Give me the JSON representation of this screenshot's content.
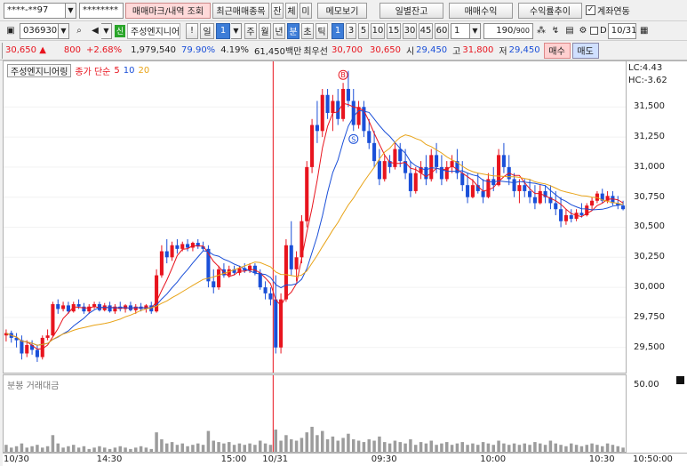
{
  "toolbar1": {
    "account_masked": "****-**97",
    "password_masked": "********",
    "btn_trade_mark": "매매마크/내역 조회",
    "btn_recent_items": "최근매매종목",
    "btn_balance": "잔",
    "btn_fill": "체",
    "btn_unfilled": "미",
    "btn_memo": "메모보기",
    "btn_daily_balance": "일별잔고",
    "btn_trade_profit": "매매수익",
    "btn_profit_trend": "수익률추이",
    "account_link_label": "계좌연동",
    "account_link_checked": true
  },
  "toolbar2": {
    "stock_code": "036930",
    "market_badge": "신",
    "stock_name": "주성엔지니어",
    "period_day": "일",
    "period_day_count": "1",
    "period_week": "주",
    "period_month": "월",
    "period_year": "년",
    "period_minute": "분",
    "period_second": "초",
    "period_tick": "틱",
    "minute_options": [
      "1",
      "3",
      "5",
      "10",
      "15",
      "30",
      "45",
      "60"
    ],
    "minute_selected": "1",
    "custom_minute": "1",
    "count_display": "190",
    "count_total": "900",
    "date_value": "10/31",
    "date_prefix": "D"
  },
  "quote": {
    "price": "30,650",
    "change_arrow": "▲",
    "change": "800",
    "change_pct": "+2.68%",
    "volume": "1,979,540",
    "volume_ratio": "79.90%",
    "turnover_rate": "4.19%",
    "amount": "61,450백만",
    "priority_label": "최우선",
    "best_ask": "30,700",
    "best_bid": "30,650",
    "open_label": "시",
    "open": "29,450",
    "high_label": "고",
    "high": "31,800",
    "low_label": "저",
    "low": "29,450",
    "buy_label": "매수",
    "sell_label": "매도"
  },
  "chart_legend": {
    "stock_name": "주성엔지니어링",
    "ma_title": "종가 단순",
    "ma_periods": [
      "5",
      "10",
      "20"
    ],
    "ma_colors": [
      "#e8141e",
      "#1a4fd8",
      "#e8a317"
    ],
    "lc_label": "LC:4.43",
    "hc_label": "HC:-3.62"
  },
  "volume_legend": {
    "title": "분봉 거래대금"
  },
  "markers": {
    "buy": "B",
    "sell": "S"
  },
  "axis": {
    "price_ticks": [
      "31,500",
      "31,250",
      "31,000",
      "30,750",
      "30,500",
      "30,250",
      "30,000",
      "29,750",
      "29,500"
    ],
    "volume_ticks": [
      "50.00"
    ],
    "time_labels": [
      "10/30",
      "14:30",
      "15:00",
      "10/31",
      "09:30",
      "10:00",
      "10:30"
    ],
    "current_time": "10:50:00"
  },
  "colors": {
    "up": "#e8141e",
    "down": "#1a4fd8",
    "day_divider": "#e8141e",
    "volume_bar": "#9c9c9c"
  },
  "chart_data": {
    "type": "candlestick",
    "price_range": [
      29350,
      31820
    ],
    "day_boundary_index": 52,
    "candles": [
      {
        "o": 29600,
        "h": 29650,
        "l": 29550,
        "c": 29620
      },
      {
        "o": 29620,
        "h": 29640,
        "l": 29540,
        "c": 29580
      },
      {
        "o": 29580,
        "h": 29620,
        "l": 29500,
        "c": 29560
      },
      {
        "o": 29560,
        "h": 29600,
        "l": 29400,
        "c": 29450
      },
      {
        "o": 29450,
        "h": 29560,
        "l": 29420,
        "c": 29520
      },
      {
        "o": 29520,
        "h": 29560,
        "l": 29440,
        "c": 29480
      },
      {
        "o": 29480,
        "h": 29520,
        "l": 29380,
        "c": 29420
      },
      {
        "o": 29420,
        "h": 29600,
        "l": 29400,
        "c": 29580
      },
      {
        "o": 29580,
        "h": 29650,
        "l": 29560,
        "c": 29600
      },
      {
        "o": 29600,
        "h": 29880,
        "l": 29590,
        "c": 29860
      },
      {
        "o": 29860,
        "h": 29900,
        "l": 29780,
        "c": 29820
      },
      {
        "o": 29820,
        "h": 29880,
        "l": 29800,
        "c": 29850
      },
      {
        "o": 29850,
        "h": 29880,
        "l": 29780,
        "c": 29800
      },
      {
        "o": 29800,
        "h": 29880,
        "l": 29790,
        "c": 29860
      },
      {
        "o": 29860,
        "h": 29900,
        "l": 29820,
        "c": 29840
      },
      {
        "o": 29840,
        "h": 29870,
        "l": 29780,
        "c": 29800
      },
      {
        "o": 29800,
        "h": 29860,
        "l": 29780,
        "c": 29840
      },
      {
        "o": 29840,
        "h": 29880,
        "l": 29820,
        "c": 29860
      },
      {
        "o": 29860,
        "h": 29880,
        "l": 29800,
        "c": 29810
      },
      {
        "o": 29810,
        "h": 29870,
        "l": 29800,
        "c": 29850
      },
      {
        "o": 29850,
        "h": 29880,
        "l": 29790,
        "c": 29800
      },
      {
        "o": 29800,
        "h": 29860,
        "l": 29780,
        "c": 29840
      },
      {
        "o": 29840,
        "h": 29880,
        "l": 29800,
        "c": 29820
      },
      {
        "o": 29820,
        "h": 29860,
        "l": 29790,
        "c": 29850
      },
      {
        "o": 29850,
        "h": 29880,
        "l": 29800,
        "c": 29810
      },
      {
        "o": 29810,
        "h": 29860,
        "l": 29780,
        "c": 29840
      },
      {
        "o": 29840,
        "h": 29870,
        "l": 29800,
        "c": 29820
      },
      {
        "o": 29820,
        "h": 29860,
        "l": 29790,
        "c": 29850
      },
      {
        "o": 29850,
        "h": 29880,
        "l": 29780,
        "c": 29800
      },
      {
        "o": 29800,
        "h": 30150,
        "l": 29790,
        "c": 30100
      },
      {
        "o": 30100,
        "h": 30350,
        "l": 30080,
        "c": 30300
      },
      {
        "o": 30300,
        "h": 30400,
        "l": 30200,
        "c": 30250
      },
      {
        "o": 30250,
        "h": 30380,
        "l": 30220,
        "c": 30350
      },
      {
        "o": 30350,
        "h": 30400,
        "l": 30280,
        "c": 30320
      },
      {
        "o": 30320,
        "h": 30380,
        "l": 30300,
        "c": 30360
      },
      {
        "o": 30360,
        "h": 30400,
        "l": 30300,
        "c": 30330
      },
      {
        "o": 30330,
        "h": 30380,
        "l": 30300,
        "c": 30370
      },
      {
        "o": 30370,
        "h": 30400,
        "l": 30320,
        "c": 30340
      },
      {
        "o": 30340,
        "h": 30380,
        "l": 30300,
        "c": 30320
      },
      {
        "o": 30320,
        "h": 30350,
        "l": 30000,
        "c": 30050
      },
      {
        "o": 30050,
        "h": 30150,
        "l": 29950,
        "c": 30000
      },
      {
        "o": 30000,
        "h": 30180,
        "l": 29980,
        "c": 30150
      },
      {
        "o": 30150,
        "h": 30200,
        "l": 30080,
        "c": 30100
      },
      {
        "o": 30100,
        "h": 30180,
        "l": 30080,
        "c": 30150
      },
      {
        "o": 30150,
        "h": 30180,
        "l": 30100,
        "c": 30120
      },
      {
        "o": 30120,
        "h": 30180,
        "l": 30100,
        "c": 30160
      },
      {
        "o": 30160,
        "h": 30200,
        "l": 30120,
        "c": 30140
      },
      {
        "o": 30140,
        "h": 30200,
        "l": 30120,
        "c": 30180
      },
      {
        "o": 30180,
        "h": 30200,
        "l": 30100,
        "c": 30120
      },
      {
        "o": 30120,
        "h": 30150,
        "l": 29980,
        "c": 30000
      },
      {
        "o": 30000,
        "h": 30050,
        "l": 29900,
        "c": 29950
      },
      {
        "o": 29950,
        "h": 30000,
        "l": 29850,
        "c": 29900
      },
      {
        "o": 29900,
        "h": 30100,
        "l": 29450,
        "c": 29500
      },
      {
        "o": 29500,
        "h": 29950,
        "l": 29450,
        "c": 29900
      },
      {
        "o": 29900,
        "h": 30400,
        "l": 29880,
        "c": 30350
      },
      {
        "o": 30350,
        "h": 30550,
        "l": 30100,
        "c": 30150
      },
      {
        "o": 30150,
        "h": 30300,
        "l": 30050,
        "c": 30250
      },
      {
        "o": 30250,
        "h": 30600,
        "l": 30200,
        "c": 30550
      },
      {
        "o": 30550,
        "h": 31050,
        "l": 30500,
        "c": 31000
      },
      {
        "o": 31000,
        "h": 31400,
        "l": 30950,
        "c": 31350
      },
      {
        "o": 31350,
        "h": 31550,
        "l": 31200,
        "c": 31300
      },
      {
        "o": 31300,
        "h": 31650,
        "l": 31250,
        "c": 31600
      },
      {
        "o": 31600,
        "h": 31650,
        "l": 31400,
        "c": 31450
      },
      {
        "o": 31450,
        "h": 31600,
        "l": 31300,
        "c": 31550
      },
      {
        "o": 31550,
        "h": 31650,
        "l": 31350,
        "c": 31400
      },
      {
        "o": 31400,
        "h": 31700,
        "l": 31380,
        "c": 31650
      },
      {
        "o": 31650,
        "h": 31800,
        "l": 31500,
        "c": 31550
      },
      {
        "o": 31550,
        "h": 31650,
        "l": 31300,
        "c": 31350
      },
      {
        "o": 31350,
        "h": 31550,
        "l": 31320,
        "c": 31500
      },
      {
        "o": 31500,
        "h": 31550,
        "l": 31250,
        "c": 31300
      },
      {
        "o": 31300,
        "h": 31400,
        "l": 31150,
        "c": 31200
      },
      {
        "o": 31200,
        "h": 31300,
        "l": 31000,
        "c": 31050
      },
      {
        "o": 31050,
        "h": 31150,
        "l": 30850,
        "c": 30900
      },
      {
        "o": 30900,
        "h": 31100,
        "l": 30880,
        "c": 31050
      },
      {
        "o": 31050,
        "h": 31100,
        "l": 30950,
        "c": 31000
      },
      {
        "o": 31000,
        "h": 31200,
        "l": 30980,
        "c": 31150
      },
      {
        "o": 31150,
        "h": 31200,
        "l": 31000,
        "c": 31050
      },
      {
        "o": 31050,
        "h": 31150,
        "l": 30900,
        "c": 30950
      },
      {
        "o": 30950,
        "h": 31050,
        "l": 30750,
        "c": 30800
      },
      {
        "o": 30800,
        "h": 31000,
        "l": 30780,
        "c": 30950
      },
      {
        "o": 30950,
        "h": 31050,
        "l": 30900,
        "c": 31000
      },
      {
        "o": 31000,
        "h": 31100,
        "l": 30850,
        "c": 30900
      },
      {
        "o": 30900,
        "h": 31150,
        "l": 30880,
        "c": 31100
      },
      {
        "o": 31100,
        "h": 31200,
        "l": 30950,
        "c": 31000
      },
      {
        "o": 31000,
        "h": 31100,
        "l": 30850,
        "c": 30900
      },
      {
        "o": 30900,
        "h": 31050,
        "l": 30880,
        "c": 31000
      },
      {
        "o": 31000,
        "h": 31100,
        "l": 30950,
        "c": 31050
      },
      {
        "o": 31050,
        "h": 31150,
        "l": 30900,
        "c": 30950
      },
      {
        "o": 30950,
        "h": 31050,
        "l": 30800,
        "c": 30850
      },
      {
        "o": 30850,
        "h": 30950,
        "l": 30700,
        "c": 30750
      },
      {
        "o": 30750,
        "h": 30900,
        "l": 30740,
        "c": 30850
      },
      {
        "o": 30850,
        "h": 30950,
        "l": 30780,
        "c": 30800
      },
      {
        "o": 30800,
        "h": 30900,
        "l": 30700,
        "c": 30750
      },
      {
        "o": 30750,
        "h": 30950,
        "l": 30740,
        "c": 30900
      },
      {
        "o": 30900,
        "h": 31000,
        "l": 30800,
        "c": 30850
      },
      {
        "o": 30850,
        "h": 31150,
        "l": 30840,
        "c": 31100
      },
      {
        "o": 31100,
        "h": 31200,
        "l": 30950,
        "c": 31000
      },
      {
        "o": 31000,
        "h": 31100,
        "l": 30850,
        "c": 30900
      },
      {
        "o": 30900,
        "h": 30950,
        "l": 30750,
        "c": 30800
      },
      {
        "o": 30800,
        "h": 30900,
        "l": 30700,
        "c": 30850
      },
      {
        "o": 30850,
        "h": 30900,
        "l": 30750,
        "c": 30800
      },
      {
        "o": 30800,
        "h": 30900,
        "l": 30700,
        "c": 30750
      },
      {
        "o": 30750,
        "h": 30850,
        "l": 30650,
        "c": 30700
      },
      {
        "o": 30700,
        "h": 30850,
        "l": 30690,
        "c": 30800
      },
      {
        "o": 30800,
        "h": 30850,
        "l": 30700,
        "c": 30750
      },
      {
        "o": 30750,
        "h": 30850,
        "l": 30650,
        "c": 30700
      },
      {
        "o": 30700,
        "h": 30800,
        "l": 30600,
        "c": 30650
      },
      {
        "o": 30650,
        "h": 30750,
        "l": 30500,
        "c": 30550
      },
      {
        "o": 30550,
        "h": 30650,
        "l": 30520,
        "c": 30600
      },
      {
        "o": 30600,
        "h": 30650,
        "l": 30540,
        "c": 30570
      },
      {
        "o": 30570,
        "h": 30650,
        "l": 30550,
        "c": 30620
      },
      {
        "o": 30620,
        "h": 30700,
        "l": 30580,
        "c": 30600
      },
      {
        "o": 30600,
        "h": 30700,
        "l": 30590,
        "c": 30680
      },
      {
        "o": 30680,
        "h": 30750,
        "l": 30640,
        "c": 30720
      },
      {
        "o": 30720,
        "h": 30800,
        "l": 30700,
        "c": 30780
      },
      {
        "o": 30780,
        "h": 30820,
        "l": 30700,
        "c": 30720
      },
      {
        "o": 30720,
        "h": 30800,
        "l": 30700,
        "c": 30760
      },
      {
        "o": 30760,
        "h": 30800,
        "l": 30680,
        "c": 30700
      },
      {
        "o": 30700,
        "h": 30760,
        "l": 30650,
        "c": 30680
      },
      {
        "o": 30680,
        "h": 30720,
        "l": 30640,
        "c": 30650
      }
    ],
    "volume": [
      5,
      3,
      4,
      6,
      3,
      4,
      5,
      3,
      4,
      12,
      6,
      3,
      4,
      5,
      3,
      4,
      2,
      3,
      4,
      3,
      2,
      3,
      4,
      3,
      2,
      3,
      4,
      3,
      2,
      14,
      9,
      6,
      7,
      5,
      6,
      4,
      5,
      6,
      5,
      15,
      8,
      7,
      6,
      7,
      5,
      6,
      5,
      6,
      5,
      8,
      6,
      5,
      16,
      8,
      12,
      9,
      8,
      10,
      14,
      18,
      12,
      15,
      9,
      11,
      8,
      10,
      13,
      9,
      8,
      7,
      9,
      8,
      11,
      7,
      6,
      8,
      7,
      6,
      9,
      5,
      7,
      6,
      8,
      5,
      6,
      7,
      5,
      6,
      7,
      5,
      6,
      5,
      7,
      6,
      5,
      8,
      6,
      5,
      6,
      5,
      6,
      5,
      7,
      6,
      5,
      8,
      6,
      5,
      4,
      6,
      5,
      4,
      5,
      6,
      5,
      4,
      6,
      5,
      4,
      3
    ],
    "volume_max": 50,
    "buy_marker_index": 65,
    "sell_marker_index": 67
  }
}
